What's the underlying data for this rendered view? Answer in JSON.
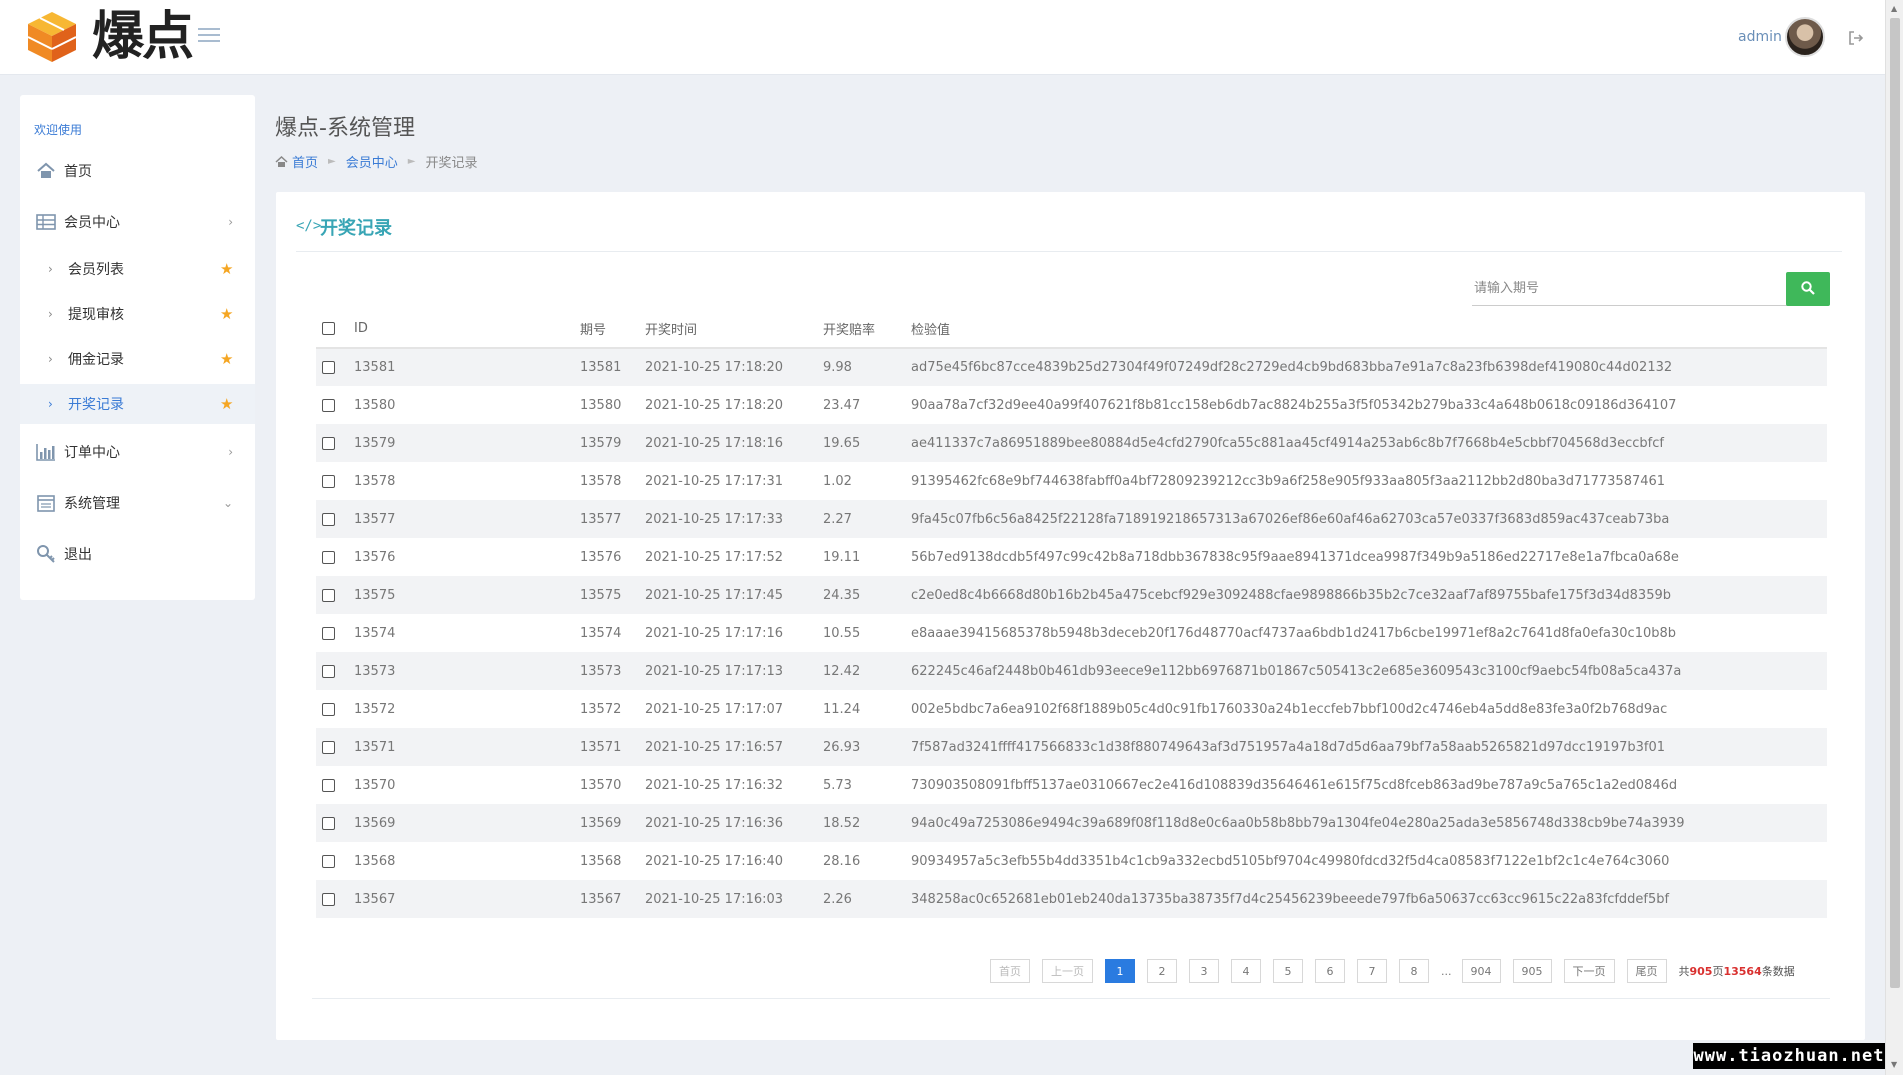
{
  "header": {
    "brand": "爆点",
    "user_name": "admin"
  },
  "sidebar": {
    "welcome": "欢迎使用",
    "items": [
      {
        "label": "首页",
        "icon": "home-icon"
      },
      {
        "label": "会员中心",
        "icon": "table-icon"
      },
      {
        "label": "订单中心",
        "icon": "bar-chart-icon"
      },
      {
        "label": "系统管理",
        "icon": "calendar-icon"
      },
      {
        "label": "退出",
        "icon": "key-icon"
      }
    ],
    "sub_items": [
      {
        "label": "会员列表"
      },
      {
        "label": "提现审核"
      },
      {
        "label": "佣金记录"
      },
      {
        "label": "开奖记录"
      }
    ]
  },
  "page": {
    "title": "爆点-系统管理",
    "breadcrumb": [
      "首页",
      "会员中心",
      "开奖记录"
    ]
  },
  "panel": {
    "title": "开奖记录",
    "search_placeholder": "请输入期号"
  },
  "table": {
    "columns": [
      "ID",
      "期号",
      "开奖时间",
      "开奖赔率",
      "检验值"
    ],
    "rows": [
      {
        "id": "13581",
        "period": "13581",
        "time": "2021-10-25 17:18:20",
        "rate": "9.98",
        "hash": "ad75e45f6bc87cce4839b25d27304f49f07249df28c2729ed4cb9bd683bba7e91a7c8a23fb6398def419080c44d02132"
      },
      {
        "id": "13580",
        "period": "13580",
        "time": "2021-10-25 17:18:20",
        "rate": "23.47",
        "hash": "90aa78a7cf32d9ee40a99f407621f8b81cc158eb6db7ac8824b255a3f5f05342b279ba33c4a648b0618c09186d364107"
      },
      {
        "id": "13579",
        "period": "13579",
        "time": "2021-10-25 17:18:16",
        "rate": "19.65",
        "hash": "ae411337c7a86951889bee80884d5e4cfd2790fca55c881aa45cf4914a253ab6c8b7f7668b4e5cbbf704568d3eccbfcf"
      },
      {
        "id": "13578",
        "period": "13578",
        "time": "2021-10-25 17:17:31",
        "rate": "1.02",
        "hash": "91395462fc68e9bf744638fabff0a4bf72809239212cc3b9a6f258e905f933aa805f3aa2112bb2d80ba3d71773587461"
      },
      {
        "id": "13577",
        "period": "13577",
        "time": "2021-10-25 17:17:33",
        "rate": "2.27",
        "hash": "9fa45c07fb6c56a8425f22128fa718919218657313a67026ef86e60af46a62703ca57e0337f3683d859ac437ceab73ba"
      },
      {
        "id": "13576",
        "period": "13576",
        "time": "2021-10-25 17:17:52",
        "rate": "19.11",
        "hash": "56b7ed9138dcdb5f497c99c42b8a718dbb367838c95f9aae8941371dcea9987f349b9a5186ed22717e8e1a7fbca0a68e"
      },
      {
        "id": "13575",
        "period": "13575",
        "time": "2021-10-25 17:17:45",
        "rate": "24.35",
        "hash": "c2e0ed8c4b6668d80b16b2b45a475cebcf929e3092488cfae9898866b35b2c7ce32aaf7af89755bafe175f3d34d8359b"
      },
      {
        "id": "13574",
        "period": "13574",
        "time": "2021-10-25 17:17:16",
        "rate": "10.55",
        "hash": "e8aaae39415685378b5948b3deceb20f176d48770acf4737aa6bdb1d2417b6cbe19971ef8a2c7641d8fa0efa30c10b8b"
      },
      {
        "id": "13573",
        "period": "13573",
        "time": "2021-10-25 17:17:13",
        "rate": "12.42",
        "hash": "622245c46af2448b0b461db93eece9e112bb6976871b01867c505413c2e685e3609543c3100cf9aebc54fb08a5ca437a"
      },
      {
        "id": "13572",
        "period": "13572",
        "time": "2021-10-25 17:17:07",
        "rate": "11.24",
        "hash": "002e5bdbc7a6ea9102f68f1889b05c4d0c91fb1760330a24b1eccfeb7bbf100d2c4746eb4a5dd8e83fe3a0f2b768d9ac"
      },
      {
        "id": "13571",
        "period": "13571",
        "time": "2021-10-25 17:16:57",
        "rate": "26.93",
        "hash": "7f587ad3241ffff417566833c1d38f880749643af3d751957a4a18d7d5d6aa79bf7a58aab5265821d97dcc19197b3f01"
      },
      {
        "id": "13570",
        "period": "13570",
        "time": "2021-10-25 17:16:32",
        "rate": "5.73",
        "hash": "730903508091fbff5137ae0310667ec2e416d108839d35646461e615f75cd8fceb863ad9be787a9c5a765c1a2ed0846d"
      },
      {
        "id": "13569",
        "period": "13569",
        "time": "2021-10-25 17:16:36",
        "rate": "18.52",
        "hash": "94a0c49a7253086e9494c39a689f08f118d8e0c6aa0b58b8bb79a1304fe04e280a25ada3e5856748d338cb9be74a3939"
      },
      {
        "id": "13568",
        "period": "13568",
        "time": "2021-10-25 17:16:40",
        "rate": "28.16",
        "hash": "90934957a5c3efb55b4dd3351b4c1cb9a332ecbd5105bf9704c49980fdcd32f5d4ca08583f7122e1bf2c1c4e764c3060"
      },
      {
        "id": "13567",
        "period": "13567",
        "time": "2021-10-25 17:16:03",
        "rate": "2.26",
        "hash": "348258ac0c652681eb01eb240da13735ba38735f7d4c25456239beeede797fb6a50637cc63cc9615c22a83fcfddef5bf"
      }
    ]
  },
  "pagination": {
    "first": "首页",
    "prev": "上一页",
    "pages": [
      "1",
      "2",
      "3",
      "4",
      "5",
      "6",
      "7",
      "8"
    ],
    "ellipsis": "...",
    "tail_pages": [
      "904",
      "905"
    ],
    "next": "下一页",
    "last": "尾页",
    "current": "1",
    "total_prefix": "共",
    "total_pages": "905",
    "total_mid": "页",
    "total_records": "13564",
    "total_suffix": "条数据"
  },
  "watermark": "www.tiaozhuan.net",
  "colors": {
    "accent": "#38a5b5",
    "link": "#3a7bd5",
    "search_button": "#3fb85a",
    "page_active": "#2a7be0",
    "star": "#f5a623",
    "total_highlight": "#d9302f"
  }
}
